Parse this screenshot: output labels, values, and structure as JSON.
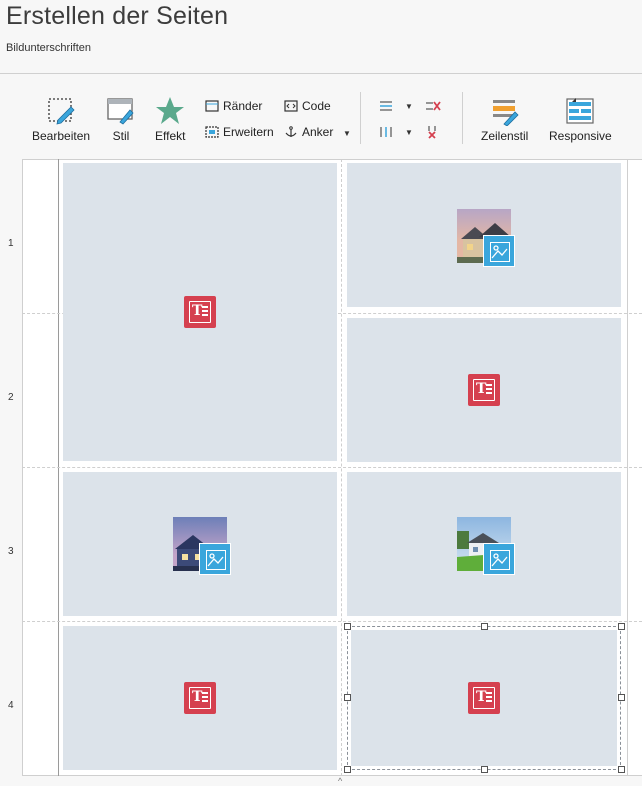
{
  "header": {
    "title": "Erstellen der Seiten",
    "subtitle": "Bildunterschriften"
  },
  "toolbar": {
    "edit_label": "Bearbeiten",
    "style_label": "Stil",
    "effect_label": "Effekt",
    "borders_label": "Ränder",
    "extend_label": "Erweitern",
    "code_label": "Code",
    "anchor_label": "Anker",
    "rowstyle_label": "Zeilenstil",
    "responsive_label": "Responsive",
    "colors": {
      "accent": "#3aa6dc",
      "text_object": "#d5404f",
      "effect": "#5aa98c",
      "rowstyle": "#f0a030"
    }
  },
  "grid": {
    "row_numbers": [
      "1",
      "2",
      "3",
      "4"
    ],
    "cells": [
      {
        "row": "1-2",
        "col": 1,
        "type": "text"
      },
      {
        "row": "1",
        "col": 2,
        "type": "image",
        "photo": "house-dusk"
      },
      {
        "row": "2",
        "col": 2,
        "type": "text"
      },
      {
        "row": "3",
        "col": 1,
        "type": "image",
        "photo": "house-night"
      },
      {
        "row": "3",
        "col": 2,
        "type": "image",
        "photo": "house-lawn"
      },
      {
        "row": "4",
        "col": 1,
        "type": "text"
      },
      {
        "row": "4",
        "col": 2,
        "type": "text",
        "selected": true
      }
    ],
    "cell_color": "#dce3ea"
  }
}
